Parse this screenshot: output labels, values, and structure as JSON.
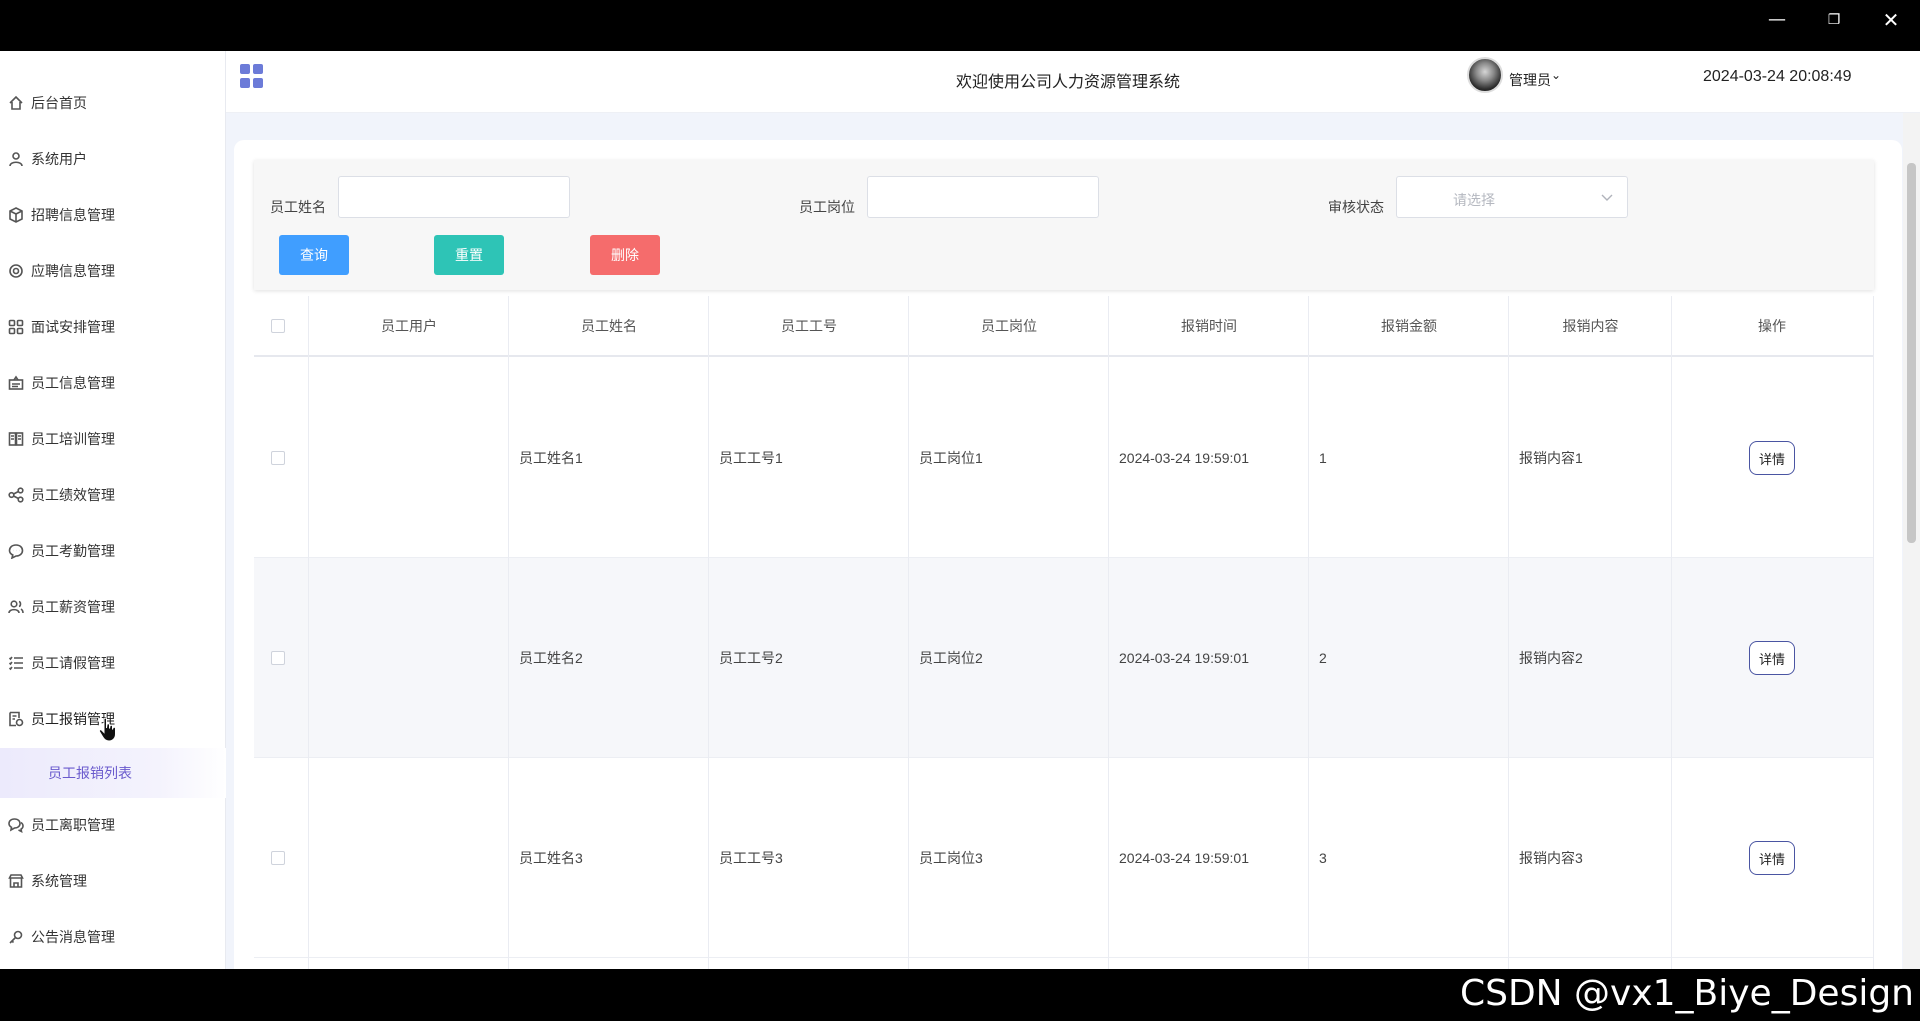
{
  "window": {
    "minimize": "—",
    "maximize": "❐",
    "close": "✕"
  },
  "header": {
    "title": "欢迎使用公司人力资源管理系统",
    "user_name": "管理员",
    "caret": "⌄",
    "datetime": "2024-03-24 20:08:49"
  },
  "sidebar": {
    "items": [
      {
        "label": "后台首页",
        "icon": "home-icon"
      },
      {
        "label": "系统用户",
        "icon": "user-icon"
      },
      {
        "label": "招聘信息管理",
        "icon": "cube-icon"
      },
      {
        "label": "应聘信息管理",
        "icon": "gear-icon"
      },
      {
        "label": "面试安排管理",
        "icon": "grid-icon"
      },
      {
        "label": "员工信息管理",
        "icon": "id-card-icon"
      },
      {
        "label": "员工培训管理",
        "icon": "book-icon"
      },
      {
        "label": "员工绩效管理",
        "icon": "share-icon"
      },
      {
        "label": "员工考勤管理",
        "icon": "chat-icon"
      },
      {
        "label": "员工薪资管理",
        "icon": "users-icon"
      },
      {
        "label": "员工请假管理",
        "icon": "list-icon"
      },
      {
        "label": "员工报销管理",
        "icon": "receipt-icon"
      },
      {
        "label": "员工离职管理",
        "icon": "chat-bubbles-icon"
      },
      {
        "label": "系统管理",
        "icon": "shop-icon"
      },
      {
        "label": "公告消息管理",
        "icon": "key-icon"
      }
    ],
    "submenu_label": "员工报销列表"
  },
  "search": {
    "name_label": "员工姓名",
    "name_value": "",
    "position_label": "员工岗位",
    "position_value": "",
    "status_label": "审核状态",
    "status_placeholder": "请选择",
    "query_button": "查询",
    "reset_button": "重置",
    "delete_button": "删除"
  },
  "colors": {
    "query": "#409eff",
    "reset": "#2ec4b6",
    "delete": "#f56c6c",
    "accent": "#6c7bd8"
  },
  "table": {
    "columns": [
      "员工用户",
      "员工姓名",
      "员工工号",
      "员工岗位",
      "报销时间",
      "报销金额",
      "报销内容",
      "操作"
    ],
    "rows": [
      {
        "user": "",
        "name": "员工姓名1",
        "id": "员工工号1",
        "position": "员工岗位1",
        "time": "2024-03-24 19:59:01",
        "amount": "1",
        "content": "报销内容1",
        "action": "详情"
      },
      {
        "user": "",
        "name": "员工姓名2",
        "id": "员工工号2",
        "position": "员工岗位2",
        "time": "2024-03-24 19:59:01",
        "amount": "2",
        "content": "报销内容2",
        "action": "详情"
      },
      {
        "user": "",
        "name": "员工姓名3",
        "id": "员工工号3",
        "position": "员工岗位3",
        "time": "2024-03-24 19:59:01",
        "amount": "3",
        "content": "报销内容3",
        "action": "详情"
      }
    ]
  },
  "watermark": "CSDN @vx1_Biye_Design"
}
